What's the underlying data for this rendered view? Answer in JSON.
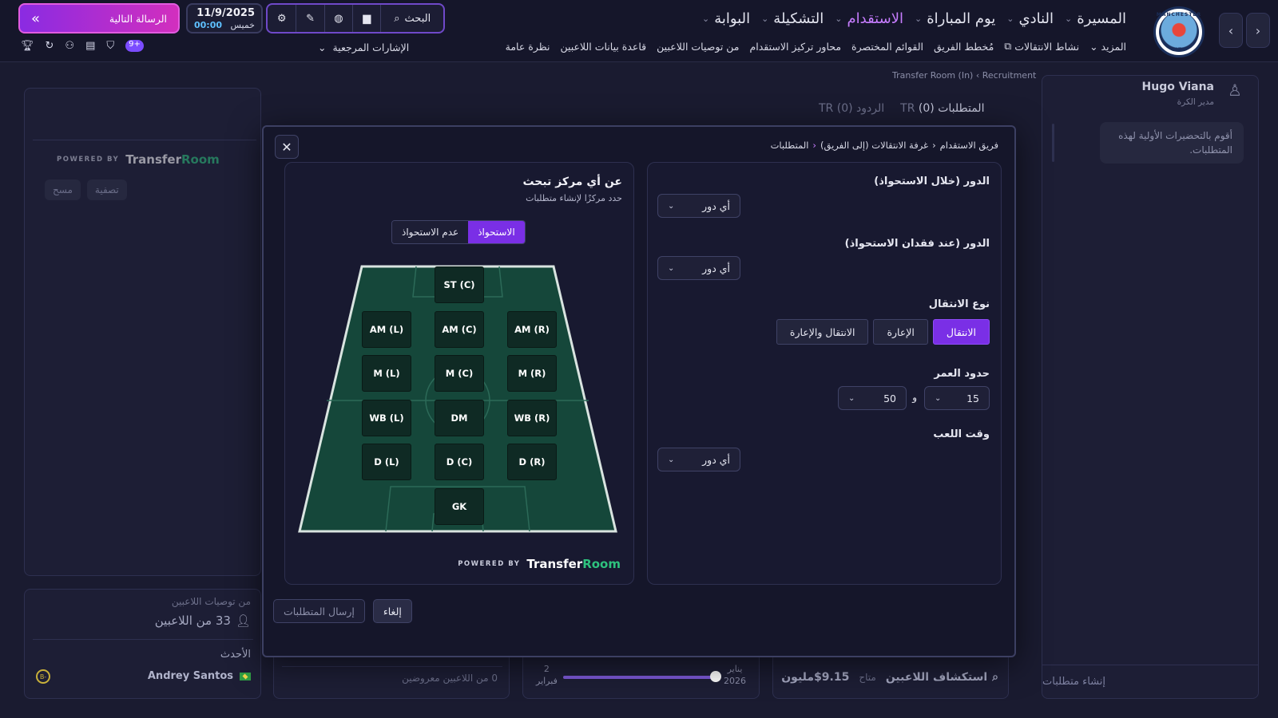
{
  "nav": {
    "main": [
      {
        "label": "البوابة",
        "active": false
      },
      {
        "label": "التشكيلة",
        "active": false
      },
      {
        "label": "الاستقدام",
        "active": true
      },
      {
        "label": "يوم المباراة",
        "active": false
      },
      {
        "label": "النادي",
        "active": false
      },
      {
        "label": "المسيرة",
        "active": false
      }
    ],
    "sub": [
      "نظرة عامة",
      "قاعدة بيانات اللاعبين",
      "من توصيات اللاعبين",
      "محاور تركيز الاستقدام",
      "القوائم المختصرة",
      "مُخطط الفريق",
      "نشاط الانتقالات",
      "المزيد"
    ],
    "club_logo_top": "MANCHESTER",
    "club_logo_bottom": "CITY",
    "search_label": "البحث",
    "date": "11/9/2025",
    "day": "خميس",
    "time": "00:00",
    "next_message": "الرسالة التالية",
    "reference_signals": "الإشارات المرجعية",
    "notif_count": "9+"
  },
  "background": {
    "breadcrumb": [
      "Recruitment",
      "Transfer Room (In)"
    ],
    "powered_by": "POWERED BY",
    "brand_a": "Transfer",
    "brand_b": "Room",
    "filter_btn": "تصفية",
    "clear_btn": "مسح",
    "tab_requirements": "المتطلبات (0)",
    "tab_responses": "الردود (0)",
    "tab_tag": "TR",
    "user_name": "Hugo Viana",
    "user_role": "مدير الكرة",
    "chat_message": "أقوم بالتحضيرات الأولية لهذه المتطلبات.",
    "create_requirements": "إنشاء متطلبات",
    "rec_label": "من توصيات اللاعبين",
    "rec_count": "33 من اللاعبين",
    "latest": "الأحدث",
    "player_name": "Andrey Santos",
    "grade": "B-",
    "players_offered": "0 من اللاعبين معروضين",
    "date_left_num": "2",
    "date_left_month": "فبراير",
    "date_right_month": "يناير",
    "date_right_year": "2026",
    "scouting": "استكشاف اللاعبين",
    "available": "متاح",
    "budget": "$9.15مليون"
  },
  "modal": {
    "breadcrumb": [
      "فريق الاستقدام",
      "غرفة الانتقالات (إلى الفريق)",
      "المتطلبات"
    ],
    "pitch_title": "عن أي مركز تبحث",
    "pitch_subtitle": "حدد مركزًا لإنشاء متطلبات",
    "toggle_possession": "الاستحواذ",
    "toggle_no_possession": "عدم الاستحواذ",
    "positions": {
      "st": "ST (C)",
      "aml": "AM (L)",
      "amc": "AM (C)",
      "amr": "AM (R)",
      "ml": "M (L)",
      "mc": "M (C)",
      "mr": "M (R)",
      "wbl": "WB (L)",
      "dm": "DM",
      "wbr": "WB (R)",
      "dl": "D (L)",
      "dc": "D (C)",
      "dr": "D (R)",
      "gk": "GK"
    },
    "role_in_possession_label": "الدور (خلال الاستحواذ)",
    "role_out_possession_label": "الدور (عند فقدان الاستحواذ)",
    "any_role": "أي دور",
    "transfer_type_label": "نوع الانتقال",
    "transfer_types": [
      "الانتقال",
      "الإعارة",
      "الانتقال والإعارة"
    ],
    "age_label": "حدود العمر",
    "age_min": "15",
    "age_max": "50",
    "and_word": "و",
    "playtime_label": "وقت اللعب",
    "send_btn": "إرسال المتطلبات",
    "cancel_btn": "إلغاء"
  }
}
